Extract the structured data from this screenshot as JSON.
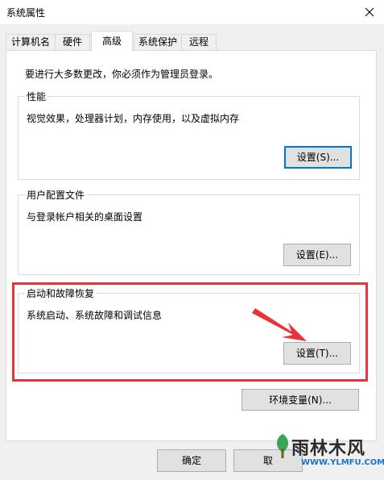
{
  "window": {
    "title": "系统属性"
  },
  "tabs": [
    {
      "label": "计算机名"
    },
    {
      "label": "硬件"
    },
    {
      "label": "高级"
    },
    {
      "label": "系统保护"
    },
    {
      "label": "远程"
    }
  ],
  "active_tab": "高级",
  "notice": "要进行大多数更改，你必须作为管理员登录。",
  "performance": {
    "legend": "性能",
    "description": "视觉效果，处理器计划，内存使用，以及虚拟内存",
    "button": "设置(S)..."
  },
  "user_profiles": {
    "legend": "用户配置文件",
    "description": "与登录帐户相关的桌面设置",
    "button": "设置(E)..."
  },
  "startup_recovery": {
    "legend": "启动和故障恢复",
    "description": "系统启动、系统故障和调试信息",
    "button": "设置(T)..."
  },
  "env_button": "环境变量(N)...",
  "footer": {
    "ok": "确定",
    "cancel": "取"
  },
  "annotation_color": "#e8333a",
  "watermark": {
    "name": "雨林木风",
    "url": "WWW.YLMFU.COM"
  }
}
